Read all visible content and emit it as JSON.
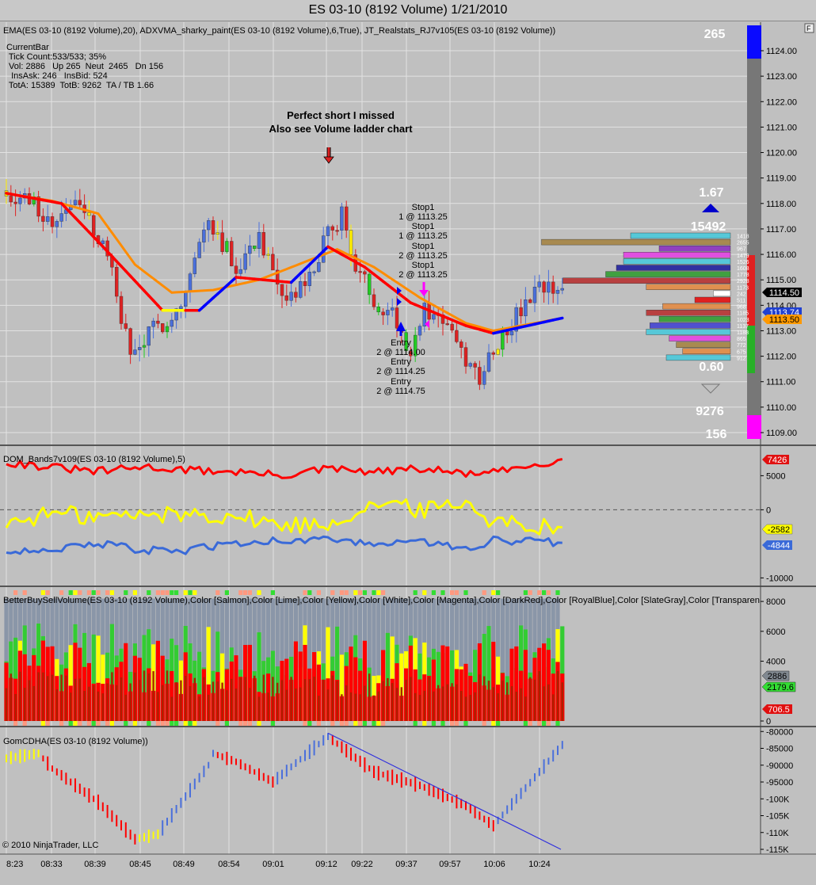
{
  "window_title": "ES 03-10 (8192 Volume)  1/21/2010",
  "colors": {
    "background": "#c0c0c0",
    "grid": "#e2e2e2",
    "ema": "#ff8c00",
    "adxvma_up": "#0000ff",
    "adxvma_down": "#ff0000",
    "adxvma_flat": "#ffff00",
    "candle_up": "#4a6fdb",
    "candle_down": "#dd2222",
    "dom_red": "#ff0000",
    "dom_yellow": "#ffff00",
    "dom_blue": "#3a6ad8",
    "bbsv_red": "#ff0000",
    "bbsv_darkred": "#aa2200",
    "bbsv_lime": "#33cc33",
    "bbsv_gray": "#8a96a8",
    "cd_red": "#ff0000",
    "cd_blue": "#4a6fdb",
    "trendline": "#3030dd"
  },
  "panel1": {
    "indicator_label": "EMA(ES 03-10 (8192 Volume),20), ADXVMA_sharky_paint(ES 03-10 (8192 Volume),6,True), JT_Realstats_RJ7v105(ES 03-10 (8192 Volume))",
    "currentbar": [
      "CurrentBar",
      " Tick Count:533/533; 35%",
      " Vol: 2886   Up 265  Neut  2465   Dn 156",
      "  InsAsk: 246   InsBid: 524",
      " TotA: 15389  TotB: 9262  TA / TB 1.66"
    ],
    "annotation_line1": "Perfect short I missed",
    "annotation_line2": "Also see Volume ladder chart",
    "stops": [
      "Stop1",
      "1 @ 1113.25",
      "Stop1",
      "1 @ 1113.25",
      "Stop1",
      "2 @ 1113.25",
      "Stop1",
      "2 @ 1113.25"
    ],
    "entries": [
      "Entry",
      "2 @ 1114.00",
      "Entry",
      "2 @ 1114.25",
      "Entry",
      "2 @ 1114.75"
    ],
    "stat_up": "265",
    "ratio_up": "1.67",
    "total_ask": "15492",
    "ratio_down": "0.60",
    "total_bid": "9276",
    "stat_down": "156",
    "price_ticks": [
      "1124.00",
      "1123.00",
      "1122.00",
      "1121.00",
      "1120.00",
      "1119.00",
      "1118.00",
      "1117.00",
      "1116.00",
      "1115.00",
      "1114.00",
      "1113.00",
      "1112.00",
      "1111.00",
      "1110.00",
      "1109.00"
    ],
    "price_min": 1109,
    "price_max": 1124,
    "last_price": "1114.50",
    "badge_blue": "1113.74",
    "badge_orange": "1113.50",
    "ladder_labels": [
      "1418",
      "2655",
      "967",
      "1479",
      "1526",
      "1608",
      "1778",
      "2928",
      "1173",
      "242",
      "511",
      "968",
      "1185",
      "1023",
      "1137",
      "1188",
      "865",
      "772",
      "675",
      "912"
    ]
  },
  "panel2": {
    "indicator_label": "DOM_Bands7v109(ES 03-10 (8192 Volume),5)",
    "ticks": [
      "5000",
      "0",
      "-10000"
    ],
    "range": [
      -11000,
      9000
    ],
    "last_red": "7426",
    "last_yellow": "-2582",
    "last_blue": "-4844"
  },
  "panel3": {
    "indicator_label": "BetterBuySellVolume(ES 03-10 (8192 Volume),Color [Salmon],Color [Lime],Color [Yellow],Color [White],Color [Magenta],Color [DarkRed],Color [RoyalBlue],Color [SlateGray],Color [Transparen",
    "ticks": [
      "8000",
      "6000",
      "4000",
      "0"
    ],
    "range": [
      0,
      8800
    ],
    "badge_gray": "2886",
    "badge_green": "2179.6",
    "badge_red": "706.5"
  },
  "panel4": {
    "indicator_label": "GomCDHA(ES 03-10 (8192 Volume))",
    "ticks": [
      "-80000",
      "-85000",
      "-90000",
      "-95000",
      "-100K",
      "-105K",
      "-110K",
      "-115K"
    ],
    "range": [
      -115000,
      -79000
    ],
    "copyright": "© 2010 NinjaTrader, LLC"
  },
  "time_labels": [
    "8:23",
    "08:33",
    "08:39",
    "08:45",
    "08:49",
    "08:54",
    "09:01",
    "09:12",
    "09:22",
    "09:37",
    "09:57",
    "10:06",
    "10:24"
  ],
  "chart_data": [
    {
      "type": "candlestick",
      "title": "ES 03-10 (8192 Volume)  1/21/2010",
      "x": [
        "8:23",
        "08:33",
        "08:39",
        "08:45",
        "08:49",
        "08:54",
        "09:01",
        "09:12",
        "09:22",
        "09:37",
        "09:57",
        "10:06",
        "10:24"
      ],
      "ylim": [
        1109,
        1124
      ],
      "series": [
        {
          "name": "EMA(20)",
          "values": [
            1118.4,
            1118.1,
            1117.6,
            1115.6,
            1114.5,
            1114.6,
            1115.0,
            1116.2,
            1115.5,
            1114.3,
            1113.3,
            1113.0,
            1113.5
          ]
        },
        {
          "name": "ADXVMA",
          "values": [
            1118.4,
            1118.0,
            1116.5,
            1113.8,
            1113.8,
            1115.1,
            1114.9,
            1116.3,
            1115.5,
            1114.1,
            1113.2,
            1112.9,
            1113.5
          ]
        }
      ]
    },
    {
      "type": "line",
      "title": "DOM_Bands7v109(ES 03-10 (8192 Volume),5)",
      "x": [
        "8:23",
        "08:33",
        "08:39",
        "08:45",
        "08:49",
        "08:54",
        "09:01",
        "09:12",
        "09:22",
        "09:37",
        "09:57",
        "10:06",
        "10:24"
      ],
      "ylim": [
        -11000,
        9000
      ],
      "series": [
        {
          "name": "red",
          "values": [
            7000,
            6200,
            5600,
            6300,
            5800,
            5600,
            5000,
            6000,
            5500,
            6000,
            5300,
            5400,
            7426
          ]
        },
        {
          "name": "yellow",
          "values": [
            -2000,
            -500,
            -1000,
            -800,
            -600,
            -900,
            -2300,
            -2100,
            1000,
            0,
            1200,
            -1700,
            -2582
          ]
        },
        {
          "name": "blue",
          "values": [
            -6000,
            -5800,
            -5000,
            -6000,
            -6000,
            -4800,
            -4500,
            -4200,
            -5200,
            -4500,
            -6000,
            -4500,
            -4844
          ]
        }
      ]
    },
    {
      "type": "bar",
      "title": "BetterBuySellVolume",
      "x": [
        "8:23",
        "08:33",
        "08:39",
        "08:45",
        "08:49",
        "08:54",
        "09:01",
        "09:12",
        "09:22",
        "09:37",
        "09:57",
        "10:06",
        "10:24"
      ],
      "ylim": [
        0,
        8800
      ],
      "series": [
        {
          "name": "total volume",
          "values": [
            8192,
            8192,
            8192,
            8192,
            8192,
            8192,
            8192,
            8192,
            8192,
            8192,
            8192,
            8192,
            2886
          ]
        },
        {
          "name": "green",
          "values": [
            2179.6
          ]
        },
        {
          "name": "red",
          "values": [
            706.5
          ]
        }
      ]
    },
    {
      "type": "bar",
      "title": "GomCDHA(ES 03-10 (8192 Volume))",
      "x": [
        "8:23",
        "08:33",
        "08:39",
        "08:45",
        "08:49",
        "08:54",
        "09:01",
        "09:12",
        "09:22",
        "09:37",
        "09:57",
        "10:06",
        "10:24"
      ],
      "ylim": [
        -115000,
        -79000
      ],
      "series": [
        {
          "name": "cumulative delta",
          "values": [
            -88000,
            -91000,
            -101000,
            -112000,
            -104000,
            -88000,
            -95000,
            -81000,
            -92000,
            -96000,
            -102000,
            -108000,
            -84000
          ]
        }
      ]
    }
  ]
}
